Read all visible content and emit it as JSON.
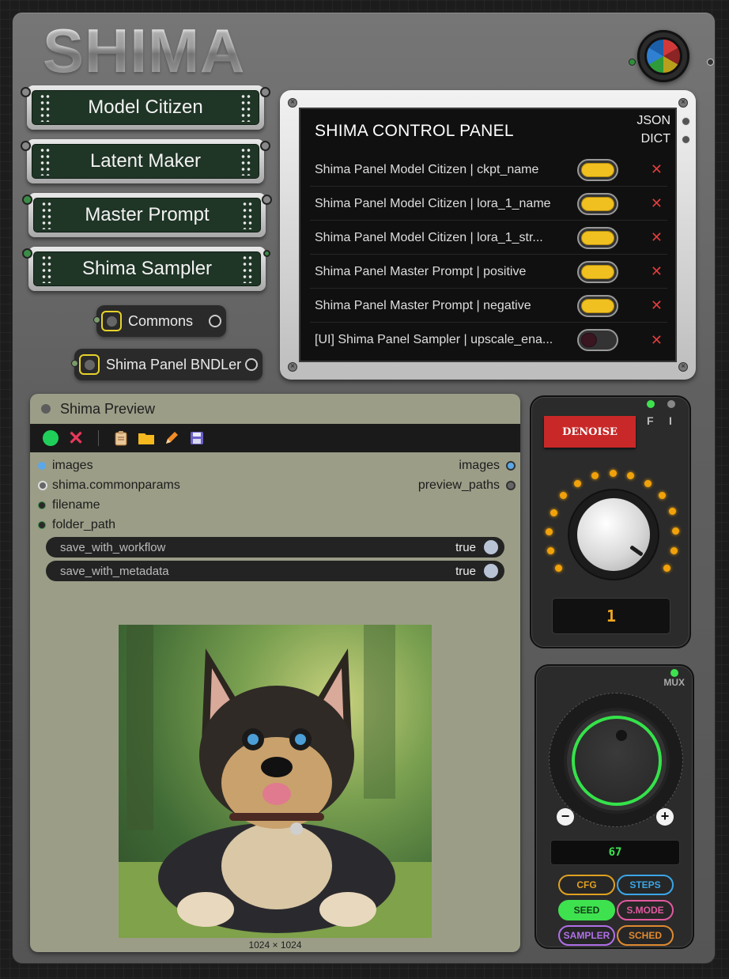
{
  "logo": "SHIMA",
  "buttons": [
    {
      "label": "Model Citizen"
    },
    {
      "label": "Latent Maker"
    },
    {
      "label": "Master Prompt"
    },
    {
      "label": "Shima Sampler"
    }
  ],
  "mini_nodes": [
    {
      "label": "Commons"
    },
    {
      "label": "Shima Panel BNDLer"
    }
  ],
  "control_panel": {
    "title": "SHIMA CONTROL PANEL",
    "outputs": [
      "JSON",
      "DICT"
    ],
    "rows": [
      {
        "label": "Shima Panel Model Citizen | ckpt_name",
        "enabled": true
      },
      {
        "label": "Shima Panel Model Citizen | lora_1_name",
        "enabled": true
      },
      {
        "label": "Shima Panel Model Citizen | lora_1_str...",
        "enabled": true
      },
      {
        "label": "Shima Panel Master Prompt | positive",
        "enabled": true
      },
      {
        "label": "Shima Panel Master Prompt | negative",
        "enabled": true
      },
      {
        "label": "[UI] Shima Panel Sampler | upscale_ena...",
        "enabled": false
      }
    ],
    "remove_glyph": "✕"
  },
  "preview": {
    "title": "Shima Preview",
    "toolbar_icons": [
      "run-icon",
      "cancel-icon",
      "clipboard-icon",
      "folder-icon",
      "pencil-icon",
      "save-icon"
    ],
    "inputs": [
      "images",
      "shima.commonparams",
      "filename",
      "folder_path"
    ],
    "outputs": [
      "images",
      "preview_paths"
    ],
    "widgets": [
      {
        "name": "save_with_workflow",
        "value": "true"
      },
      {
        "name": "save_with_metadata",
        "value": "true"
      }
    ],
    "image_size": "1024 × 1024"
  },
  "denoise": {
    "label": "DENOISE",
    "f_label": "F",
    "i_label": "I",
    "value": "1"
  },
  "mux": {
    "label": "MUX",
    "value": "67",
    "minus": "−",
    "plus": "+",
    "modes": [
      {
        "label": "CFG",
        "color": "#e0a020"
      },
      {
        "label": "STEPS",
        "color": "#3aa6e8"
      },
      {
        "label": "SEED",
        "color": "#3ee24f",
        "active": true
      },
      {
        "label": "S.MODE",
        "color": "#e05aa0"
      },
      {
        "label": "SAMPLER",
        "color": "#b070e8"
      },
      {
        "label": "SCHED",
        "color": "#e08a30"
      }
    ]
  },
  "colors": {
    "accent_yellow": "#f0c020",
    "panel_green": "#1f3526",
    "preview_bg": "#9b9d87",
    "denoise_red": "#c92828",
    "mux_green": "#35e24a"
  }
}
